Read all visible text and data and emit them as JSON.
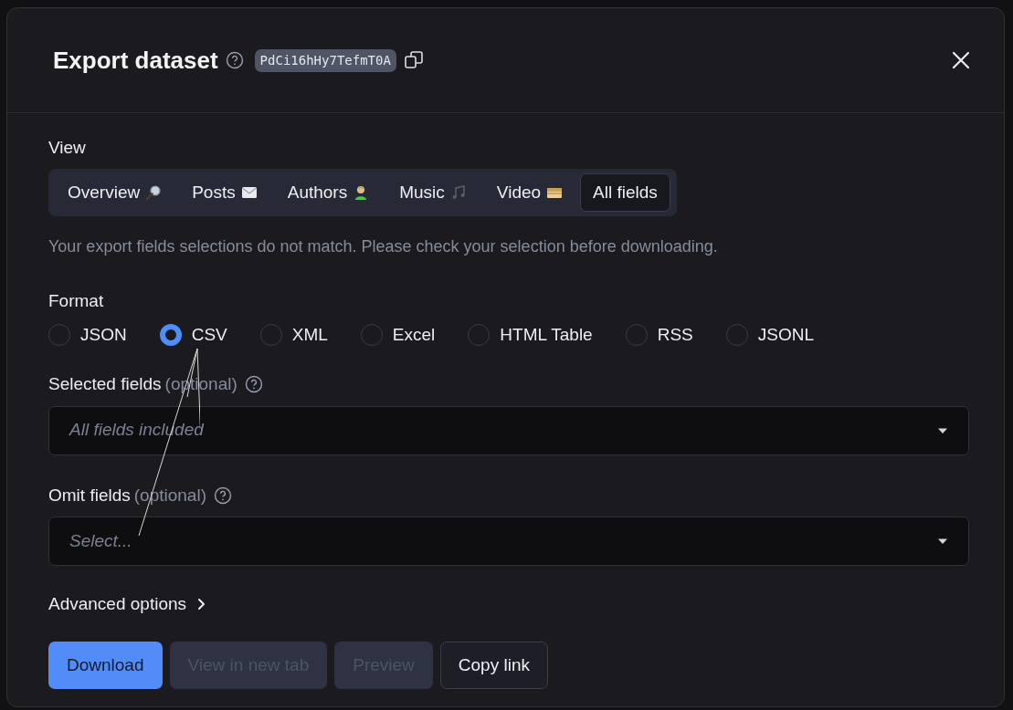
{
  "dialog": {
    "title": "Export dataset",
    "dataset_id": "PdCi16hHy7TefmT0A"
  },
  "view": {
    "label": "View",
    "tabs": [
      {
        "label": "Overview",
        "selected": false
      },
      {
        "label": "Posts",
        "selected": false
      },
      {
        "label": "Authors",
        "selected": false
      },
      {
        "label": "Music",
        "selected": false
      },
      {
        "label": "Video",
        "selected": false
      },
      {
        "label": "All fields",
        "selected": true
      }
    ]
  },
  "warning": "Your export fields selections do not match. Please check your selection before downloading.",
  "format": {
    "label": "Format",
    "options": [
      {
        "label": "JSON",
        "selected": false
      },
      {
        "label": "CSV",
        "selected": true
      },
      {
        "label": "XML",
        "selected": false
      },
      {
        "label": "Excel",
        "selected": false
      },
      {
        "label": "HTML Table",
        "selected": false
      },
      {
        "label": "RSS",
        "selected": false
      },
      {
        "label": "JSONL",
        "selected": false
      }
    ]
  },
  "fields": [
    {
      "label": "Selected fields",
      "note": "(optional)",
      "placeholder": "All fields included"
    },
    {
      "label": "Omit fields",
      "note": "(optional)",
      "placeholder": "Select..."
    }
  ],
  "advanced": {
    "label": "Advanced options",
    "expanded": false
  },
  "buttons": [
    {
      "label": "Download",
      "kind": "primary",
      "disabled": false
    },
    {
      "label": "View in new tab",
      "kind": "secondary",
      "disabled": true
    },
    {
      "label": "Preview",
      "kind": "secondary",
      "disabled": true
    },
    {
      "label": "Copy link",
      "kind": "outline",
      "disabled": false
    }
  ]
}
